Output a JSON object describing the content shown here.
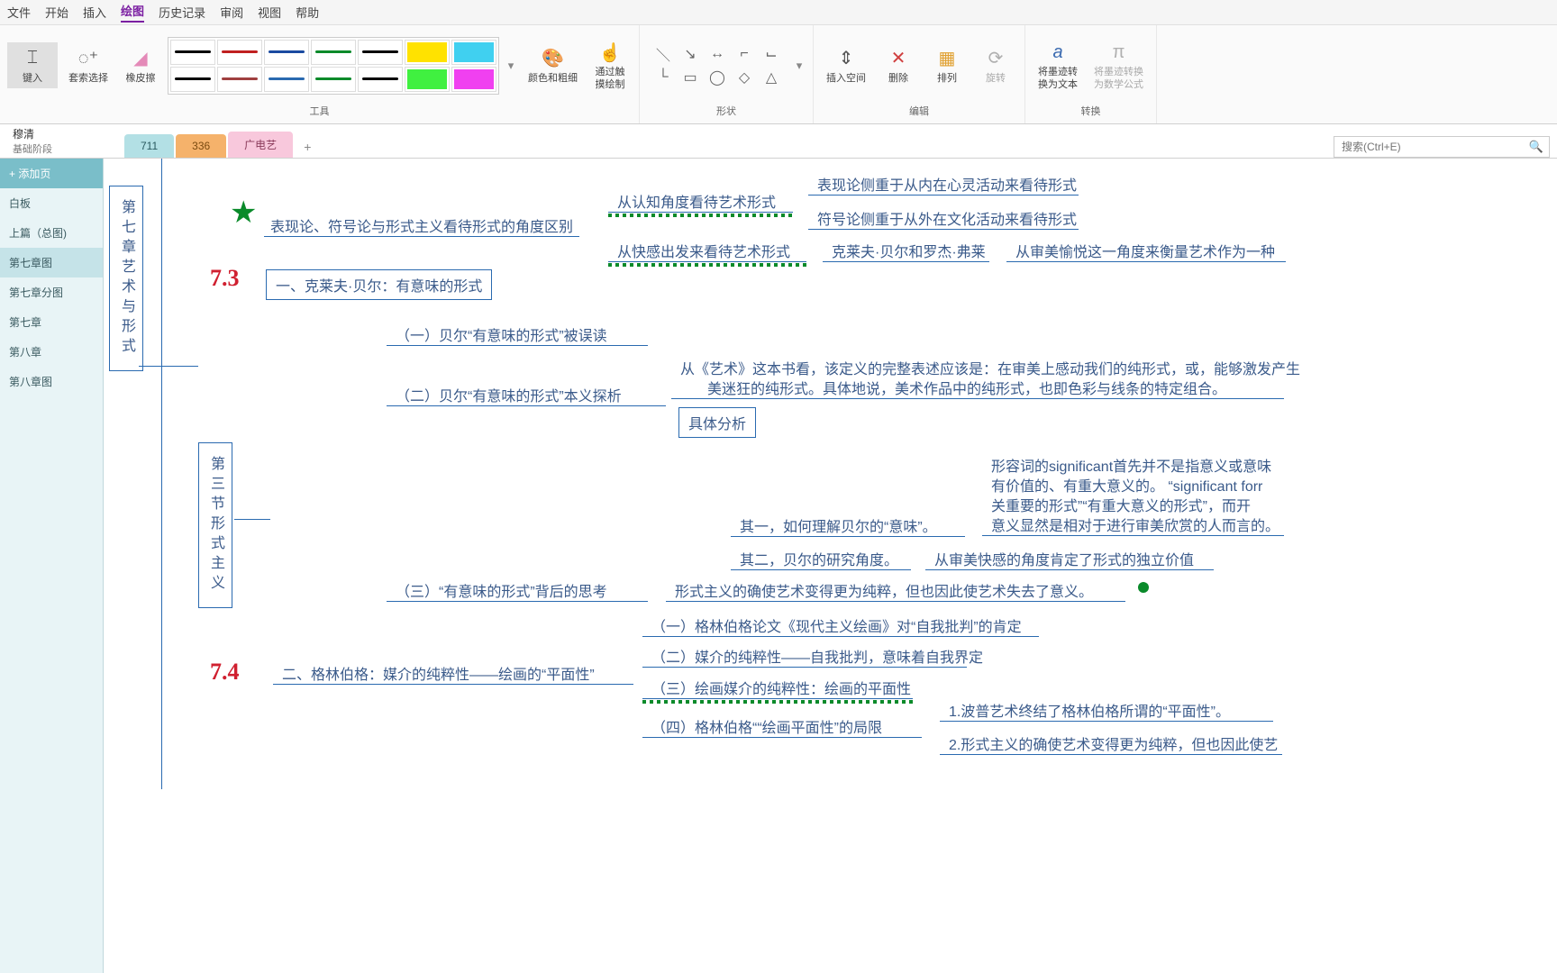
{
  "menu": {
    "items": [
      "文件",
      "开始",
      "插入",
      "绘图",
      "历史记录",
      "审阅",
      "视图",
      "帮助"
    ],
    "active_index": 3
  },
  "ribbon": {
    "groups": {
      "tools": {
        "label": "工具",
        "input_label": "键入",
        "lasso_label": "套索选择",
        "eraser_label": "橡皮擦"
      },
      "pens": {
        "colors_row1": [
          "#000",
          "#c02020",
          "#1a4aa0",
          "#0a8a2a",
          "#000",
          "#ffe200",
          "#40d0f0"
        ],
        "colors_row2": [
          "#000",
          "#a04040",
          "#2a6ab0",
          "#0a8a2a",
          "#000",
          "#40f040",
          "#f040f0"
        ],
        "highlighter_cols": [
          4,
          5,
          6
        ],
        "color_label": "颜色和粗细",
        "touch_label": "通过触\n摸绘制"
      },
      "shapes": {
        "label": "形状"
      },
      "edit": {
        "label": "编辑",
        "insert_space": "插入空间",
        "delete": "删除",
        "arrange": "排列",
        "rotate": "旋转"
      },
      "convert": {
        "label": "转换",
        "to_text": "将墨迹转\n换为文本",
        "to_math": "将墨迹转换\n为数学公式"
      }
    }
  },
  "notebook": {
    "title": "穆清",
    "section": "基础阶段"
  },
  "tabs": {
    "t711": "711",
    "t336": "336",
    "gdy": "广电艺",
    "add": "+"
  },
  "search": {
    "placeholder": "搜索(Ctrl+E)"
  },
  "pages": {
    "add": "+ 添加页",
    "items": [
      "白板",
      "上篇（总图)",
      "第七章图",
      "第七章分图",
      "第七章",
      "第八章",
      "第八章图"
    ],
    "selected_index": 2
  },
  "mindmap": {
    "root_ch7": "第七章艺术与形式",
    "sec3": "第三节形式主义",
    "n_top": "表现论、符号论与形式主义看待形式的角度区别",
    "n_top_a": "从认知角度看待艺术形式",
    "n_top_a1": "表现论侧重于从内在心灵活动来看待形式",
    "n_top_a2": "符号论侧重于从外在文化活动来看待形式",
    "n_top_b": "从快感出发来看待艺术形式",
    "n_top_b1": "克莱夫·贝尔和罗杰·弗莱",
    "n_top_b2": "从审美愉悦这一角度来衡量艺术作为一种",
    "n_1": "一、克莱夫·贝尔：有意味的形式",
    "n_1_1": "（一）贝尔“有意味的形式”被误读",
    "n_1_2": "（二）贝尔“有意味的形式”本义探析",
    "n_1_2_text1": "从《艺术》这本书看，该定义的完整表述应该是：在审美上感动我们的纯形式，或，能够激发产生",
    "n_1_2_text2": "美迷狂的纯形式。具体地说，美术作品中的纯形式，也即色彩与线条的特定组合。",
    "n_1_2_box": "具体分析",
    "n_1_2_a": "其一，如何理解贝尔的“意味”。",
    "n_1_2_a_t1": "形容词的significant首先并不是指意义或意味",
    "n_1_2_a_t2": "有价值的、有重大意义的。 “significant forr",
    "n_1_2_a_t3": "关重要的形式”“有重大意义的形式”，而开",
    "n_1_2_a_t4": "意义显然是相对于进行审美欣赏的人而言的。",
    "n_1_2_b": "其二，贝尔的研究角度。",
    "n_1_2_b_t": "从审美快感的角度肯定了形式的独立价值",
    "n_1_3": "（三）“有意味的形式”背后的思考",
    "n_1_3_t": "形式主义的确使艺术变得更为纯粹，但也因此使艺术失去了意义。",
    "n_2": "二、格林伯格：媒介的纯粹性——绘画的“平面性”",
    "n_2_1": "（一）格林伯格论文《现代主义绘画》对“自我批判”的肯定",
    "n_2_2": "（二）媒介的纯粹性——自我批判，意味着自我界定",
    "n_2_3": "（三）绘画媒介的纯粹性：绘画的平面性",
    "n_2_4": "（四）格林伯格““绘画平面性”的局限",
    "n_2_4_1": "1.波普艺术终结了格林伯格所谓的“平面性”。",
    "n_2_4_2": "2.形式主义的确使艺术变得更为纯粹，但也因此使艺",
    "ink_73": "7.3",
    "ink_74": "7.4"
  }
}
